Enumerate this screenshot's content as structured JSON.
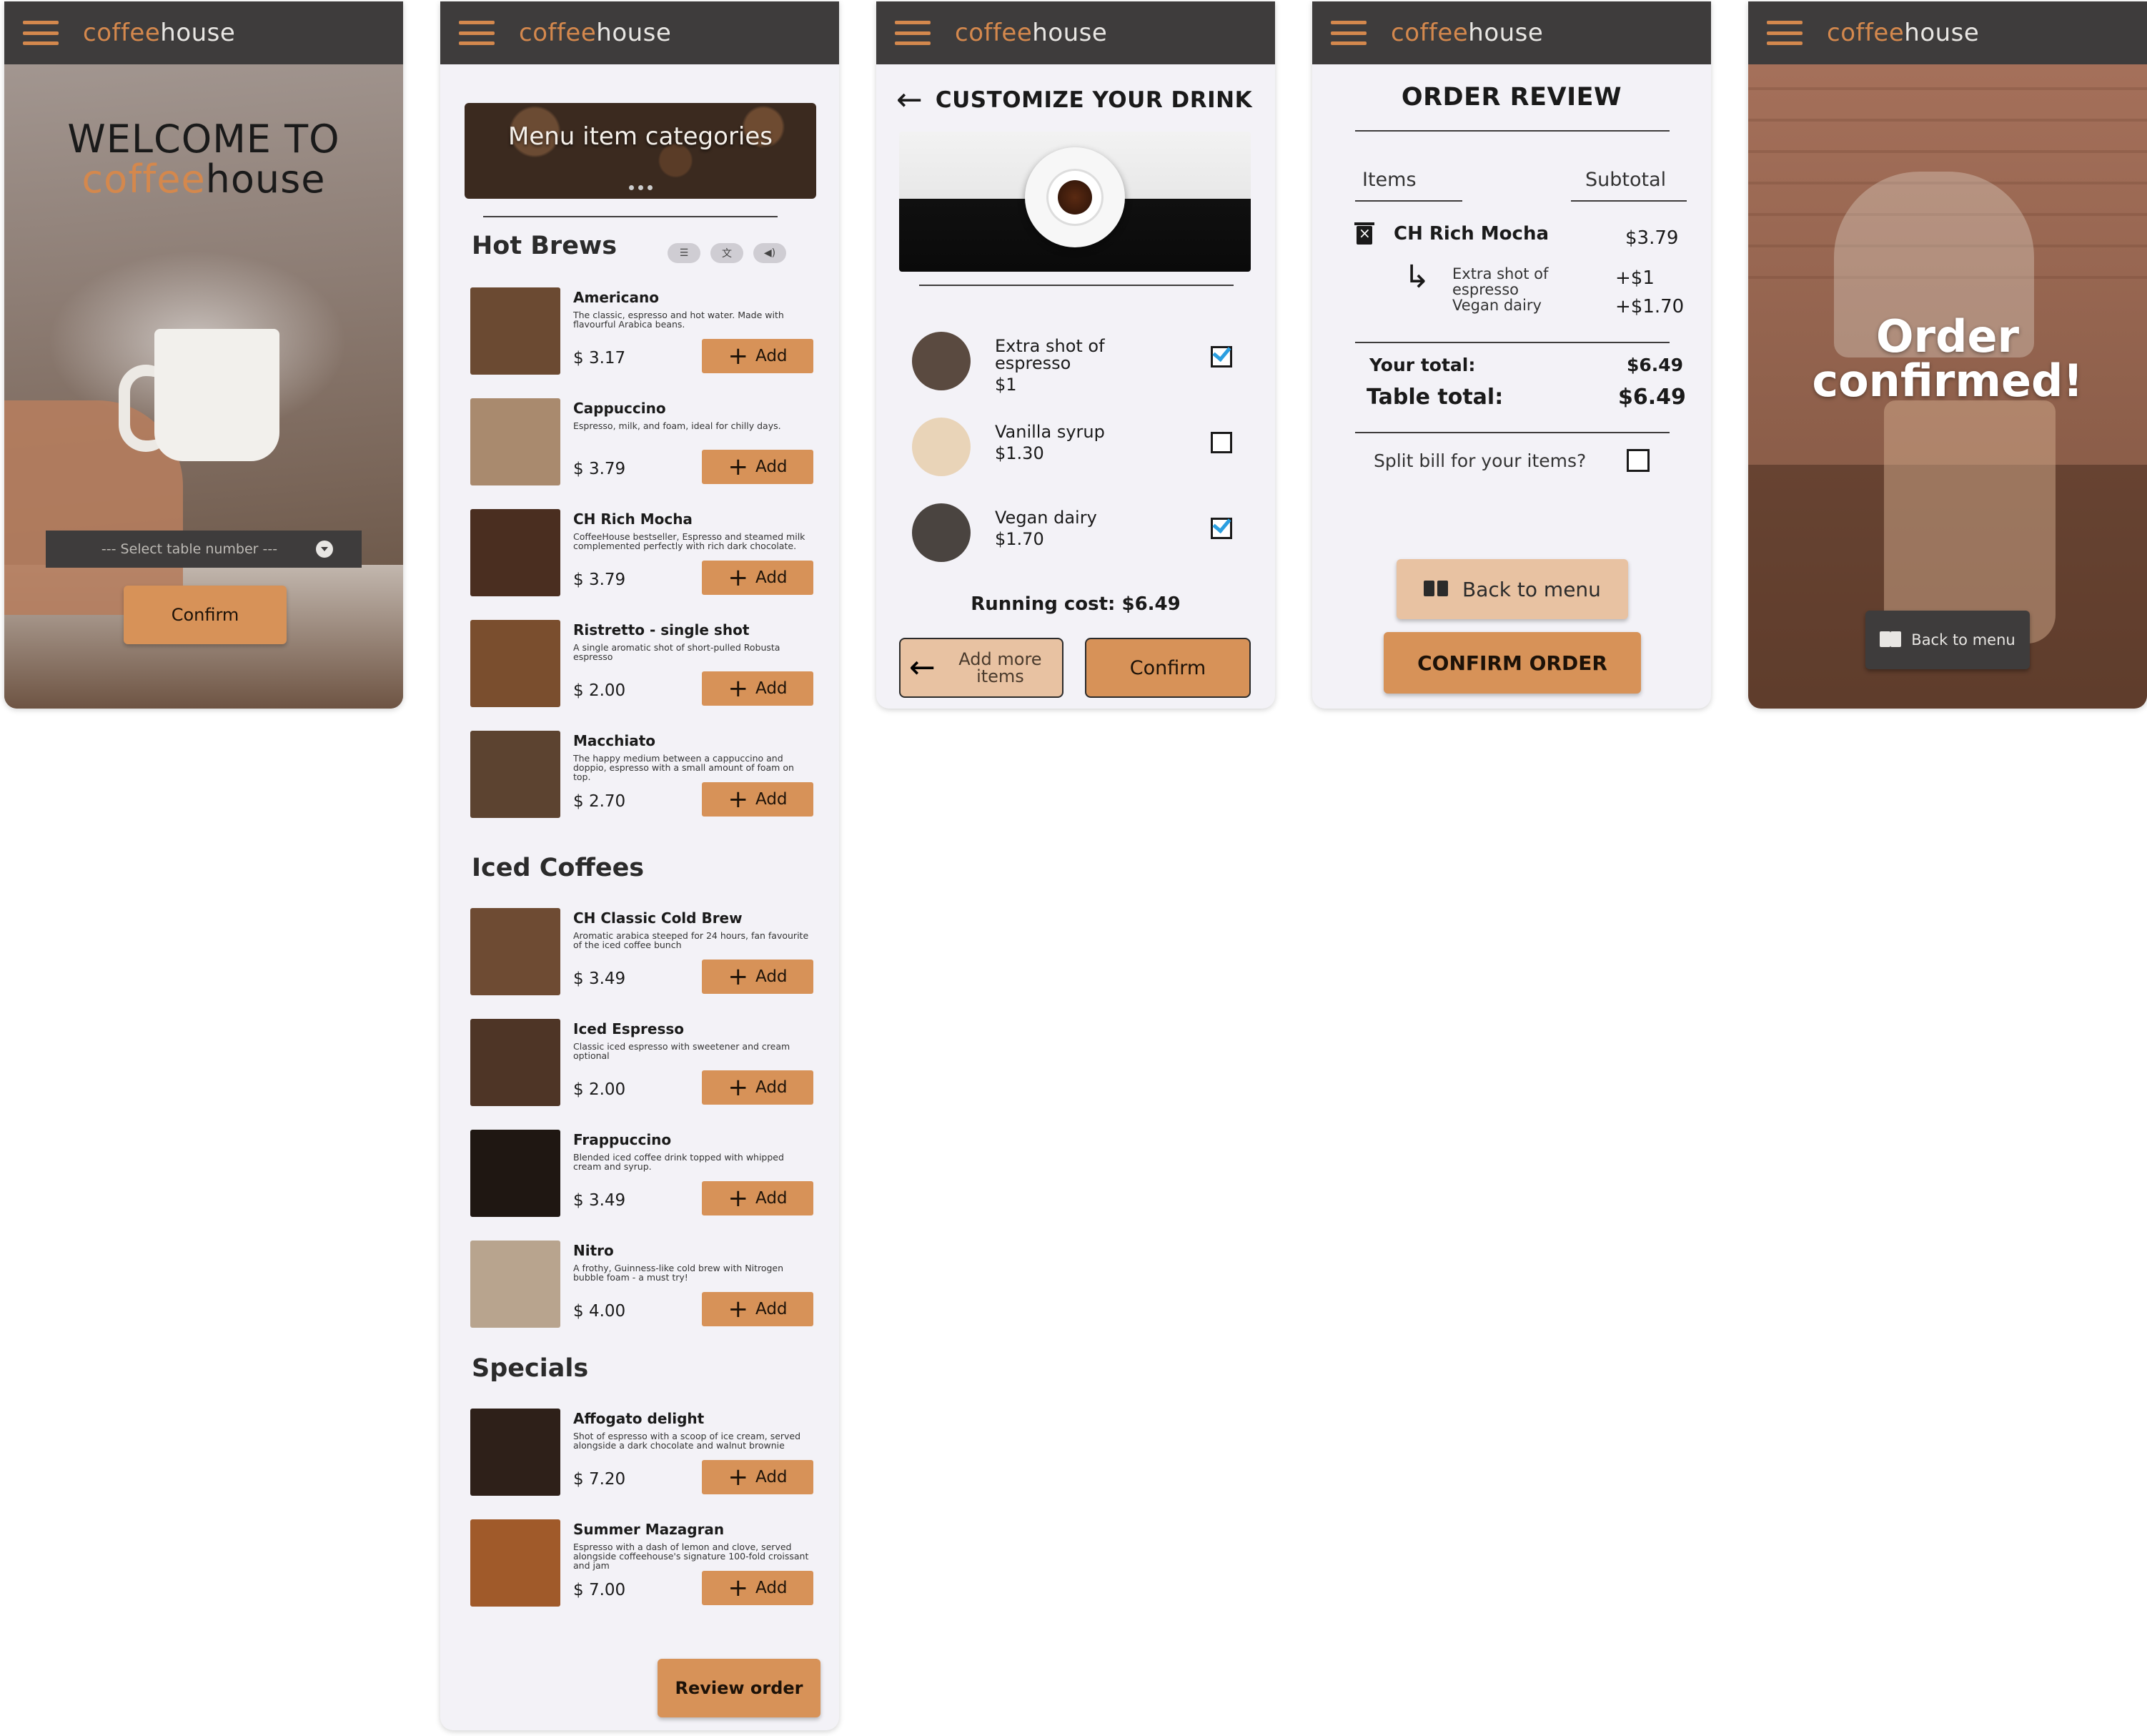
{
  "brand": {
    "part1": "coffee",
    "part2": "house"
  },
  "colors": {
    "accent": "#d79258",
    "bar": "#3e3c3c",
    "check": "#2b9fe0"
  },
  "welcome": {
    "title_line1": "WELCOME TO",
    "title_brand1": "coffee",
    "title_brand2": "house",
    "select_placeholder": "--- Select table number ---",
    "confirm_label": "Confirm"
  },
  "menu": {
    "banner_text": "Menu item categories",
    "sections": [
      {
        "title": "Hot Brews",
        "items": [
          {
            "name": "Americano",
            "desc": "The classic, espresso and hot water. Made with flavourful Arabica beans.",
            "price": "$ 3.17",
            "thumb_color": "#6b4a32"
          },
          {
            "name": "Cappuccino",
            "desc": "Espresso, milk, and foam, ideal for chilly days.",
            "price": "$ 3.79",
            "thumb_color": "#a98a6e"
          },
          {
            "name": "CH Rich Mocha",
            "desc": "CoffeeHouse bestseller, Espresso and steamed milk complemented perfectly with rich dark chocolate.",
            "price": "$ 3.79",
            "thumb_color": "#4a2e20"
          },
          {
            "name": "Ristretto - single shot",
            "desc": "A single aromatic shot of short-pulled Robusta espresso",
            "price": "$ 2.00",
            "thumb_color": "#7a4e2e"
          },
          {
            "name": "Macchiato",
            "desc": "The happy medium between a cappuccino and doppio, espresso with a small amount of foam on top.",
            "price": "$ 2.70",
            "thumb_color": "#5c4330"
          }
        ]
      },
      {
        "title": "Iced Coffees",
        "items": [
          {
            "name": "CH Classic Cold Brew",
            "desc": "Aromatic arabica steeped for 24 hours, fan favourite of the iced coffee bunch",
            "price": "$ 3.49",
            "thumb_color": "#6e4b33"
          },
          {
            "name": "Iced Espresso",
            "desc": "Classic iced espresso with sweetener and cream optional",
            "price": "$ 2.00",
            "thumb_color": "#4e3526"
          },
          {
            "name": "Frappuccino",
            "desc": "Blended iced coffee drink topped with whipped cream and syrup.",
            "price": "$ 3.49",
            "thumb_color": "#1f1712"
          },
          {
            "name": "Nitro",
            "desc": "A frothy, Guinness-like cold brew with Nitrogen bubble foam - a must try!",
            "price": "$ 4.00",
            "thumb_color": "#b8a48e"
          }
        ]
      },
      {
        "title": "Specials",
        "items": [
          {
            "name": "Affogato delight",
            "desc": "Shot of espresso with a scoop of ice cream, served alongside a dark chocolate and walnut brownie",
            "price": "$ 7.20",
            "thumb_color": "#2e2019"
          },
          {
            "name": "Summer Mazagran",
            "desc": "Espresso with a dash of lemon and clove, served alongside coffeehouse's signature 100-fold croissant and jam",
            "price": "$ 7.00",
            "thumb_color": "#a05a2a"
          }
        ]
      }
    ],
    "add_label": "Add",
    "review_label": "Review order"
  },
  "customize": {
    "title": "CUSTOMIZE YOUR DRINK",
    "options": [
      {
        "label": "Extra shot of espresso",
        "price": "$1",
        "checked": true,
        "img_color": "#5a4a40"
      },
      {
        "label": "Vanilla syrup",
        "price": "$1.30",
        "checked": false,
        "img_color": "#e9d4b8"
      },
      {
        "label": "Vegan dairy",
        "price": "$1.70",
        "checked": true,
        "img_color": "#4a4440"
      }
    ],
    "running_cost": "Running cost: $6.49",
    "add_more_label": "Add more items",
    "confirm_label": "Confirm"
  },
  "review": {
    "title": "ORDER REVIEW",
    "col_items": "Items",
    "col_subtotal": "Subtotal",
    "item_name": "CH Rich Mocha",
    "item_price": "$3.79",
    "extra1_label": "Extra shot of espresso",
    "extra1_price": "+$1",
    "extra2_label": "Vegan dairy",
    "extra2_price": "+$1.70",
    "your_total_label": "Your total:",
    "your_total": "$6.49",
    "table_total_label": "Table total:",
    "table_total": "$6.49",
    "split_label": "Split bill for your items?",
    "back_label": "Back to menu",
    "confirm_label": "CONFIRM ORDER"
  },
  "confirmed": {
    "message": "Order confirmed!",
    "back_label": "Back to menu"
  }
}
